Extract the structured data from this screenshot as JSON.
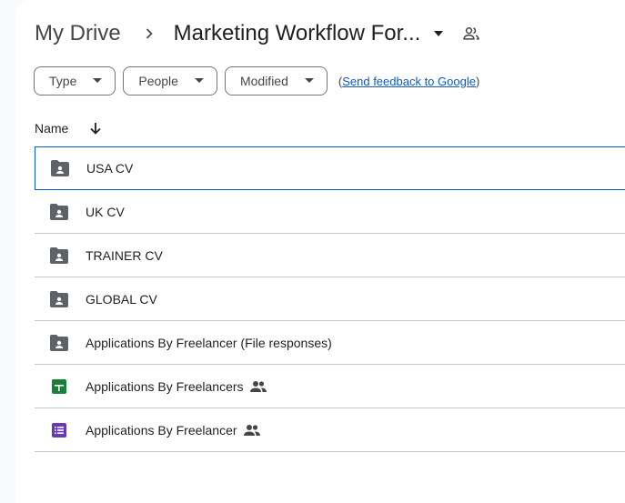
{
  "breadcrumb": {
    "root": "My Drive",
    "current": "Marketing Workflow For..."
  },
  "filters": [
    {
      "label": "Type"
    },
    {
      "label": "People"
    },
    {
      "label": "Modified"
    }
  ],
  "feedback": {
    "open": "(",
    "link": "Send feedback to Google",
    "close": ")"
  },
  "sort": {
    "label": "Name",
    "direction_icon": "arrow-down-icon"
  },
  "files": [
    {
      "name": "USA CV",
      "type": "shared-folder",
      "shared": false,
      "selected": true
    },
    {
      "name": "UK CV",
      "type": "shared-folder",
      "shared": false
    },
    {
      "name": "TRAINER CV",
      "type": "shared-folder",
      "shared": false
    },
    {
      "name": "GLOBAL CV",
      "type": "shared-folder",
      "shared": false
    },
    {
      "name": "Applications By Freelancer (File responses)",
      "type": "shared-folder",
      "shared": false
    },
    {
      "name": "Applications By Freelancers",
      "type": "google-sheets",
      "shared": true
    },
    {
      "name": "Applications By Freelancer",
      "type": "google-forms",
      "shared": true
    }
  ],
  "colors": {
    "folder": "#5f6368",
    "sheets": "#188038",
    "forms": "#673ab7",
    "accent": "#0b57d0"
  }
}
